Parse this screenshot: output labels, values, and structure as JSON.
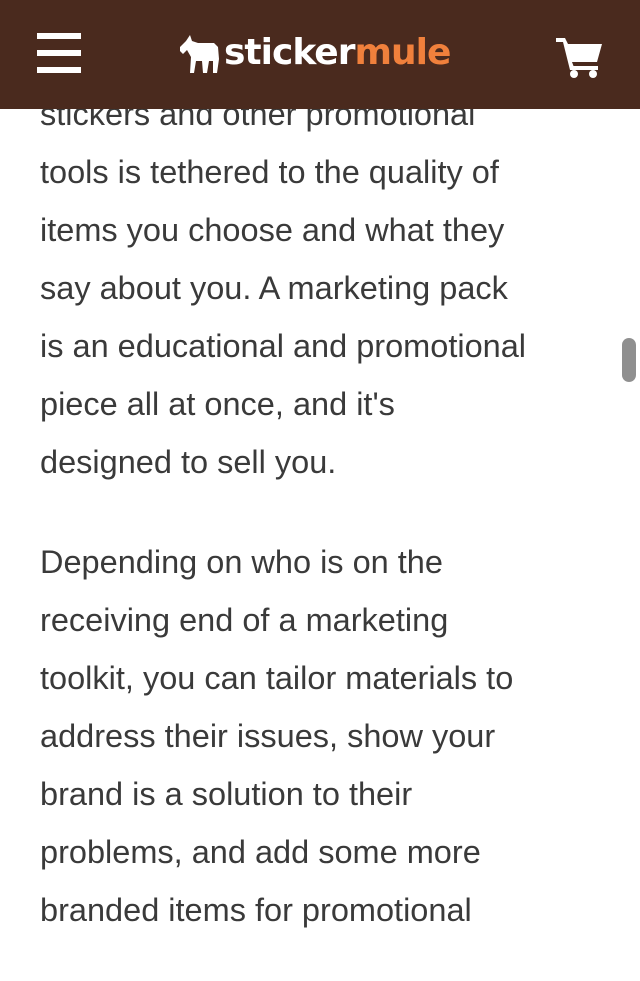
{
  "header": {
    "logo_text_1": "sticker",
    "logo_text_2": "mule",
    "logo_icon": "mule-icon",
    "menu_icon": "hamburger-menu-icon",
    "cart_icon": "shopping-cart-icon",
    "colors": {
      "background": "#4a2a1e",
      "logo_accent": "#f0803c",
      "icon": "#ffffff"
    }
  },
  "article": {
    "paragraphs": [
      "stickers and other promotional\ntools is tethered to the quality of\nitems you choose and what they\nsay about you. A marketing pack\nis an educational and promotional\npiece all at once, and it's\ndesigned to sell you.",
      "Depending on who is on the\nreceiving end of a marketing\ntoolkit, you can tailor materials to\naddress their issues, show your\nbrand is a solution to their\nproblems, and add some more\nbranded items for promotional"
    ],
    "text_color": "#3a3a3a"
  }
}
